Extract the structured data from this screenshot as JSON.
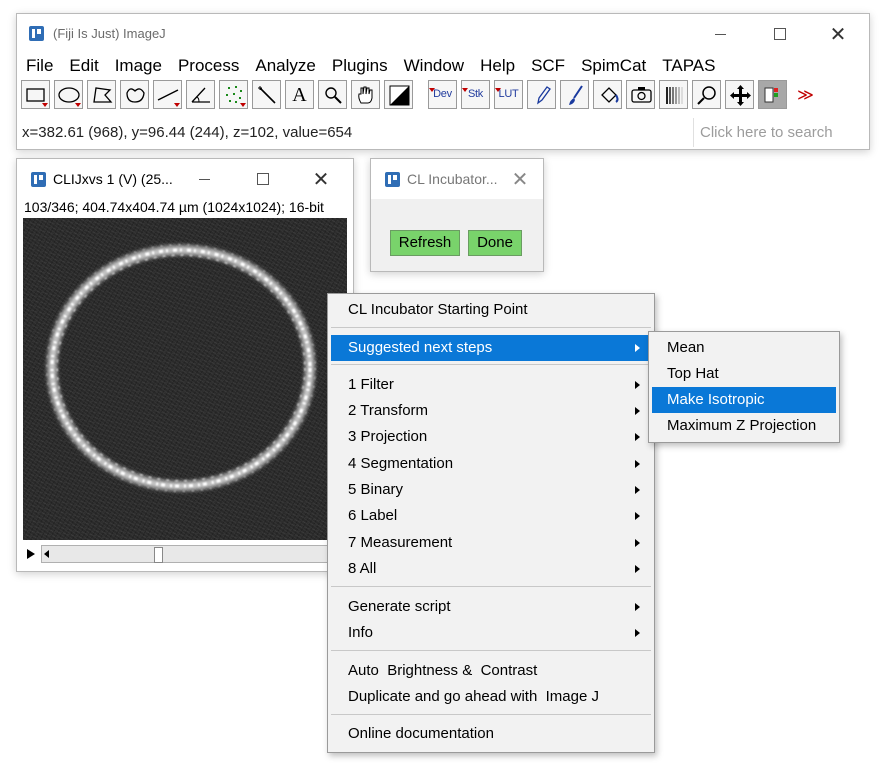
{
  "main_window": {
    "title": "(Fiji Is Just) ImageJ",
    "menus": [
      "File",
      "Edit",
      "Image",
      "Process",
      "Analyze",
      "Plugins",
      "Window",
      "Help",
      "SCF",
      "SpimCat",
      "TAPAS"
    ],
    "tools": {
      "text_tool": "A",
      "dev": "Dev",
      "stk": "Stk",
      "lut": "LUT",
      "more": "≫"
    },
    "status": "x=382.61 (968), y=96.44 (244), z=102, value=654",
    "search_placeholder": "Click here to search"
  },
  "image_window": {
    "title": "CLIJxvs 1 (V) (25...",
    "info": "103/346; 404.74x404.74 µm (1024x1024); 16-bit"
  },
  "incubator_window": {
    "title": "CL Incubator...",
    "refresh_label": "Refresh",
    "done_label": "Done",
    "button_color": "#79d36b"
  },
  "context_menu": {
    "starting_point": "CL Incubator Starting Point",
    "suggested": "Suggested next steps",
    "categories": [
      "1 Filter",
      "2 Transform",
      "3 Projection",
      "4 Segmentation",
      "5 Binary",
      "6 Label",
      "7 Measurement",
      "8 All"
    ],
    "generate_script": "Generate script",
    "info": "Info",
    "auto_brightness": "Auto  Brightness &  Contrast",
    "duplicate": "Duplicate and go ahead with  Image J",
    "online_docs": "Online documentation",
    "highlight_color": "#0a78d7"
  },
  "submenu": {
    "items": [
      "Mean",
      "Top Hat",
      "Make Isotropic",
      "Maximum Z Projection"
    ],
    "highlighted": "Make Isotropic"
  }
}
